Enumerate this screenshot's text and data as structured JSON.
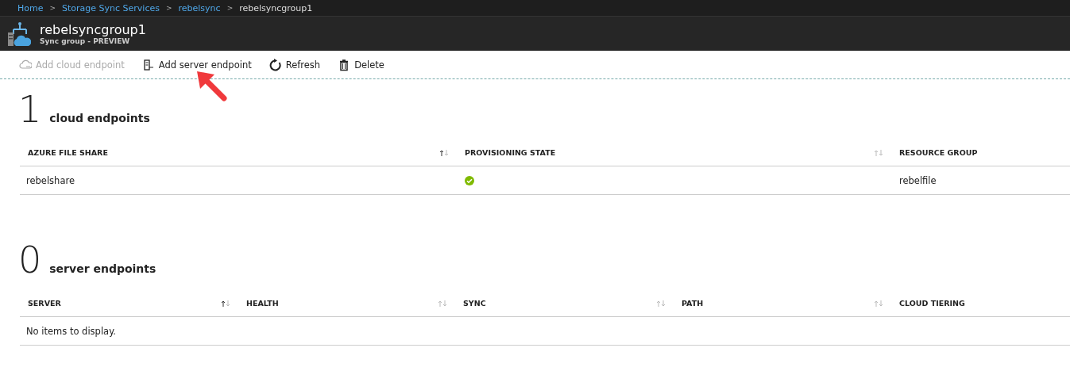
{
  "breadcrumb": [
    {
      "label": "Home"
    },
    {
      "label": "Storage Sync Services"
    },
    {
      "label": "rebelsync"
    },
    {
      "label": "rebelsyncgroup1"
    }
  ],
  "breadcrumb_separator": ">",
  "header": {
    "title": "rebelsyncgroup1",
    "subtitle": "Sync group - PREVIEW"
  },
  "toolbar": [
    {
      "kind": "cloud",
      "label": "Add cloud endpoint",
      "disabled": true
    },
    {
      "kind": "server",
      "label": "Add server endpoint",
      "disabled": false
    },
    {
      "kind": "refresh",
      "label": "Refresh",
      "disabled": false
    },
    {
      "kind": "delete",
      "label": "Delete",
      "disabled": false
    }
  ],
  "sections": [
    {
      "count": "1",
      "title": "cloud endpoints",
      "columns": [
        {
          "label": "AZURE FILE SHARE",
          "sortable": true,
          "sorted": true
        },
        {
          "label": "PROVISIONING STATE",
          "sortable": true,
          "sorted": false
        },
        {
          "label": "RESOURCE GROUP"
        }
      ],
      "rows": [
        [
          {
            "kind": "text",
            "text": "rebelshare"
          },
          {
            "kind": "success_icon"
          },
          {
            "kind": "text",
            "text": "rebelfile"
          }
        ]
      ]
    },
    {
      "count": "0",
      "title": "server endpoints",
      "columns": [
        {
          "label": "SERVER",
          "sortable": true,
          "sorted": true
        },
        {
          "label": "HEALTH",
          "sortable": true,
          "sorted": false
        },
        {
          "label": "SYNC",
          "sortable": true,
          "sorted": false
        },
        {
          "label": "PATH",
          "sortable": true,
          "sorted": false
        },
        {
          "label": "CLOUD TIERING"
        }
      ],
      "empty_message": "No items to display."
    }
  ]
}
